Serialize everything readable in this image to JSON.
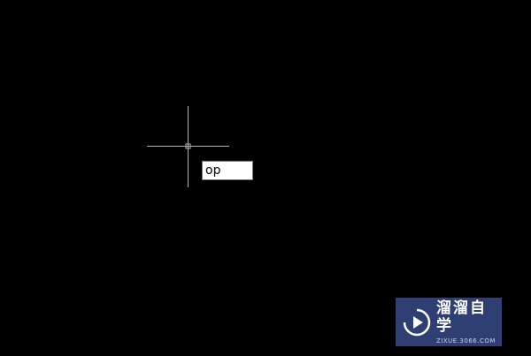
{
  "canvas": {
    "background": "#000000"
  },
  "cursor": {
    "icon": "crosshair-icon",
    "color": "#b4b4b4"
  },
  "command_input": {
    "value": "op"
  },
  "watermark": {
    "logo_icon": "play-circle-icon",
    "text": "溜溜自学",
    "url": "ZIXUE.3066.COM",
    "color": "#2f3f73"
  }
}
